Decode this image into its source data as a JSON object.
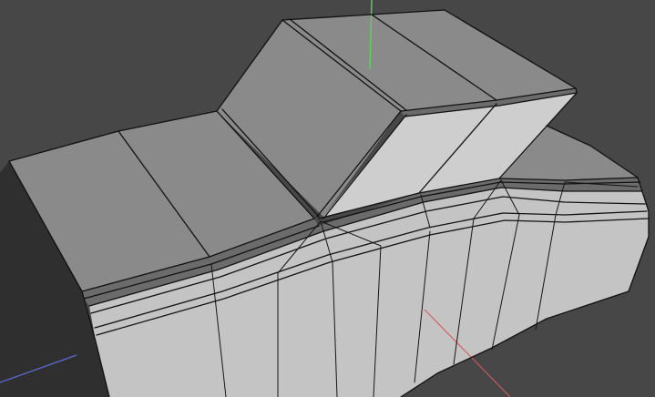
{
  "viewport": {
    "background": "#474747",
    "view": "perspective"
  },
  "mesh": {
    "shading": "solid-gray-with-wireframe",
    "colors": {
      "top_face": "#8a8a8a",
      "top_face_dark": "#7a7a7a",
      "side_face": "#c4c4c4",
      "side_face_light": "#cecece",
      "bevel": "#6b6b6b",
      "left_side": "#2f2f2f",
      "edge": "#111111"
    }
  },
  "axes": {
    "y_axis_color": "#5bd35b",
    "x_axis_color": "#d35b5b",
    "z_axis_color": "#5b6bd3"
  }
}
